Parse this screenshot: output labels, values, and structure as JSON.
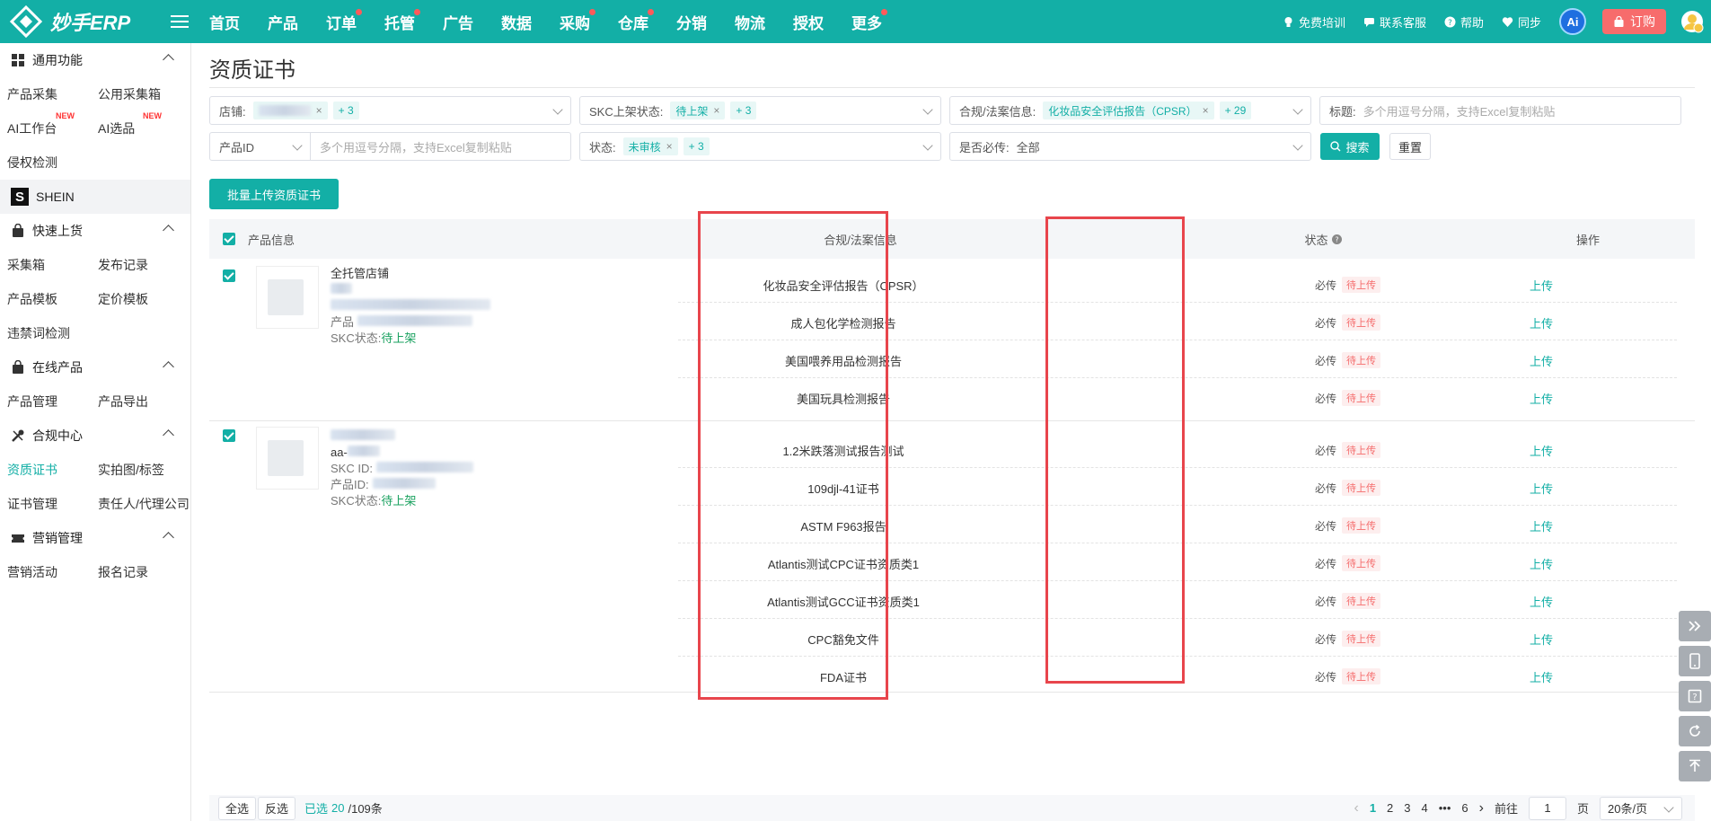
{
  "app": {
    "logo_text": "妙手ERP"
  },
  "nav": [
    {
      "label": "首页",
      "dot": false
    },
    {
      "label": "产品",
      "dot": false
    },
    {
      "label": "订单",
      "dot": true
    },
    {
      "label": "托管",
      "dot": true
    },
    {
      "label": "广告",
      "dot": false
    },
    {
      "label": "数据",
      "dot": false
    },
    {
      "label": "采购",
      "dot": true
    },
    {
      "label": "仓库",
      "dot": true
    },
    {
      "label": "分销",
      "dot": false
    },
    {
      "label": "物流",
      "dot": false
    },
    {
      "label": "授权",
      "dot": false
    },
    {
      "label": "更多",
      "dot": true
    }
  ],
  "topright": {
    "training": "免费培训",
    "support": "联系客服",
    "help": "帮助",
    "sync": "同步",
    "ai": "Ai",
    "order": "订购"
  },
  "sidebar": {
    "common": {
      "title": "通用功能",
      "items": [
        "产品采集",
        "公用采集箱",
        "AI工作台",
        "AI选品",
        "侵权检测"
      ],
      "new_badge": "NEW"
    },
    "shein": "SHEIN",
    "quick": {
      "title": "快速上货",
      "items": [
        "采集箱",
        "发布记录",
        "产品模板",
        "定价模板",
        "违禁词检测"
      ]
    },
    "online": {
      "title": "在线产品",
      "items": [
        "产品管理",
        "产品导出"
      ]
    },
    "compliance": {
      "title": "合规中心",
      "items": [
        "资质证书",
        "实拍图/标签",
        "证书管理",
        "责任人/代理公司"
      ]
    },
    "marketing": {
      "title": "营销管理",
      "items": [
        "营销活动",
        "报名记录"
      ]
    }
  },
  "page": {
    "title": "资质证书"
  },
  "filters": {
    "store_label": "店铺:",
    "store_more": "+ 3",
    "skc_label": "SKC上架状态:",
    "skc_tag": "待上架",
    "skc_more": "+ 3",
    "compliance_label": "合规/法案信息:",
    "compliance_tag": "化妆品安全评估报告（CPSR）",
    "compliance_more": "+ 29",
    "title_label": "标题:",
    "title_placeholder": "多个用逗号分隔，支持Excel复制粘贴",
    "product_id_select": "产品ID",
    "product_id_placeholder": "多个用逗号分隔，支持Excel复制粘贴",
    "status_label": "状态:",
    "status_tag": "未审核",
    "status_more": "+ 3",
    "required_label": "是否必传:",
    "required_value": "全部",
    "search_btn": "搜索",
    "reset_btn": "重置"
  },
  "batch_upload_btn": "批量上传资质证书",
  "table": {
    "col_product": "产品信息",
    "col_compliance": "合规/法案信息",
    "col_status": "状态",
    "col_action": "操作",
    "products": [
      {
        "store": "全托管店铺",
        "line_label": "产品",
        "skc_label": "SKC状态:",
        "skc_value": "待上架"
      },
      {
        "name_prefix": "aa-",
        "skc_id_label": "SKC ID:",
        "product_id_label": "产品ID:",
        "skc_label": "SKC状态:",
        "skc_value": "待上架"
      }
    ],
    "rows": [
      {
        "name": "化妆品安全评估报告（CPSR）",
        "required": "必传",
        "state": "待上传",
        "action": "上传"
      },
      {
        "name": "成人包化学检测报告",
        "required": "必传",
        "state": "待上传",
        "action": "上传"
      },
      {
        "name": "美国喂养用品检测报告",
        "required": "必传",
        "state": "待上传",
        "action": "上传"
      },
      {
        "name": "美国玩具检测报告",
        "required": "必传",
        "state": "待上传",
        "action": "上传"
      },
      {
        "name": "1.2米跌落测试报告测试",
        "required": "必传",
        "state": "待上传",
        "action": "上传"
      },
      {
        "name": "109djl-41证书",
        "required": "必传",
        "state": "待上传",
        "action": "上传"
      },
      {
        "name": "ASTM F963报告",
        "required": "必传",
        "state": "待上传",
        "action": "上传"
      },
      {
        "name": "Atlantis测试CPC证书资质类1",
        "required": "必传",
        "state": "待上传",
        "action": "上传"
      },
      {
        "name": "Atlantis测试GCC证书资质类1",
        "required": "必传",
        "state": "待上传",
        "action": "上传"
      },
      {
        "name": "CPC豁免文件",
        "required": "必传",
        "state": "待上传",
        "action": "上传"
      },
      {
        "name": "FDA证书",
        "required": "必传",
        "state": "待上传",
        "action": "上传"
      }
    ]
  },
  "footer": {
    "select_all": "全选",
    "invert": "反选",
    "selected_prefix": "已选",
    "selected_count": "20",
    "total": "/109条",
    "pages": [
      "1",
      "2",
      "3",
      "4",
      "•••",
      "6"
    ],
    "goto_label": "前往",
    "goto_value": "1",
    "page_unit": "页",
    "page_size": "20条/页"
  }
}
